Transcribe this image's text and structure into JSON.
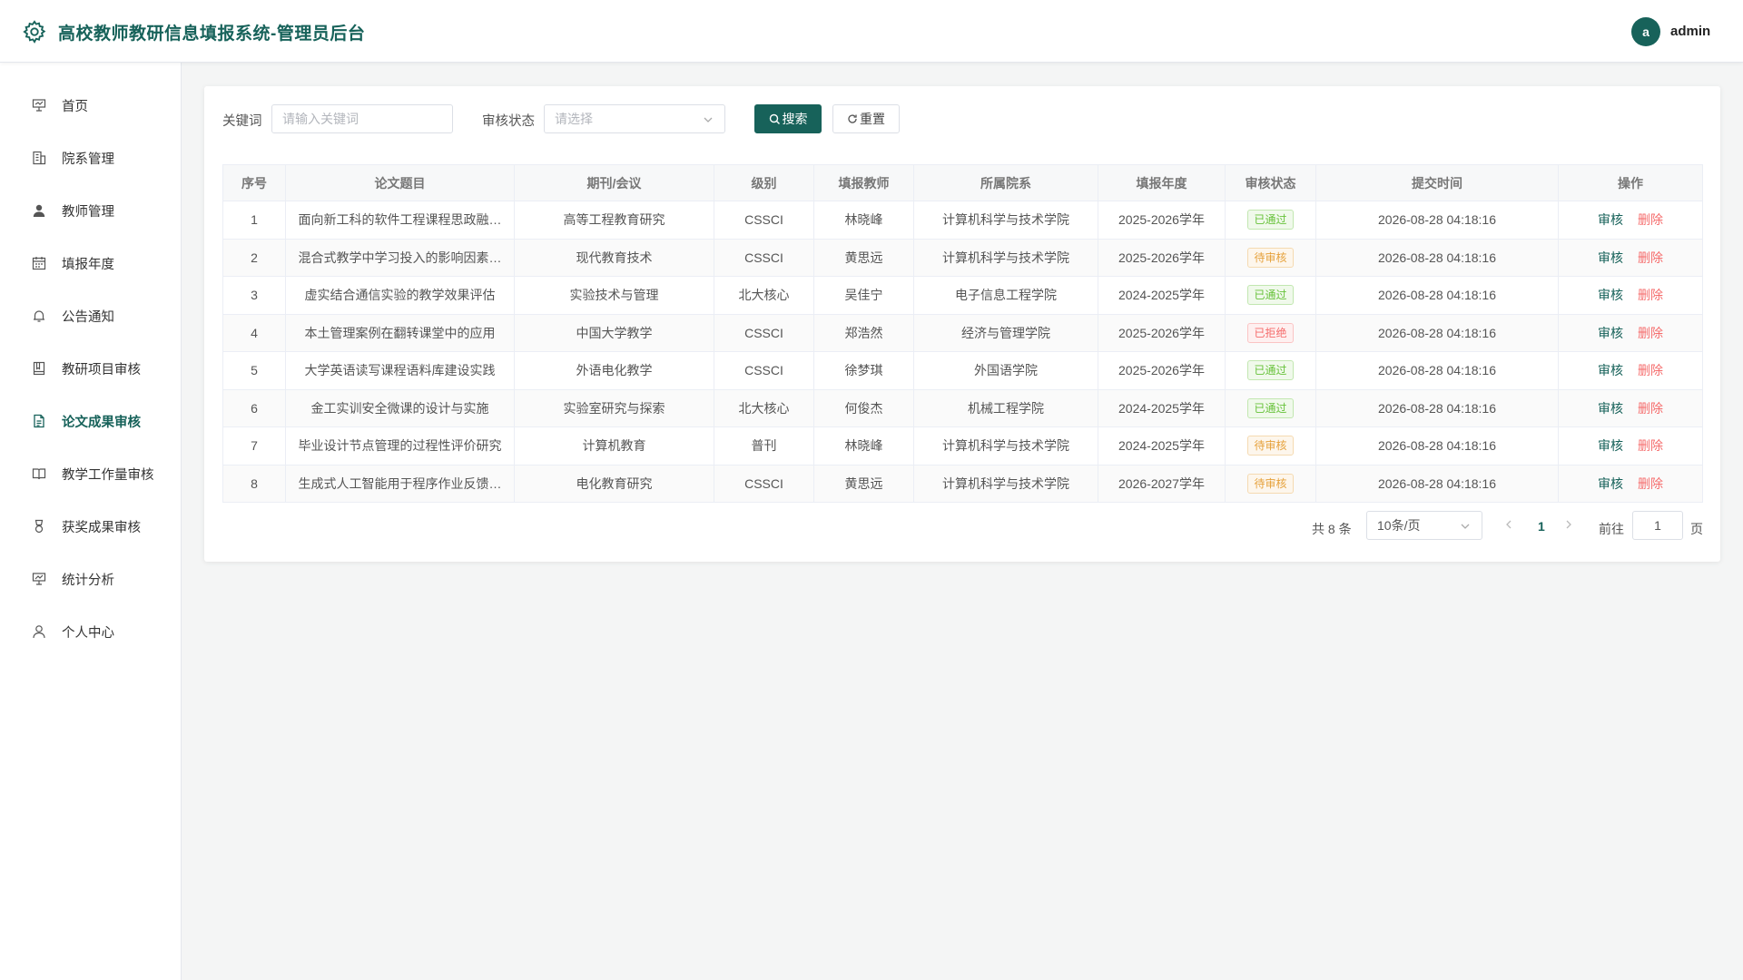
{
  "header": {
    "title": "高校教师教研信息填报系统-管理员后台",
    "avatar_letter": "a",
    "username": "admin",
    "accent": "#17625a"
  },
  "sidebar": {
    "items": [
      {
        "label": "首页",
        "icon": "presentation-icon"
      },
      {
        "label": "院系管理",
        "icon": "building-icon"
      },
      {
        "label": "教师管理",
        "icon": "user-filled-icon"
      },
      {
        "label": "填报年度",
        "icon": "calendar-icon"
      },
      {
        "label": "公告通知",
        "icon": "bell-icon"
      },
      {
        "label": "教研项目审核",
        "icon": "notebook-icon"
      },
      {
        "label": "论文成果审核",
        "icon": "document-icon",
        "active": true
      },
      {
        "label": "教学工作量审核",
        "icon": "book-icon"
      },
      {
        "label": "获奖成果审核",
        "icon": "medal-icon"
      },
      {
        "label": "统计分析",
        "icon": "chart-icon"
      },
      {
        "label": "个人中心",
        "icon": "user-icon"
      }
    ]
  },
  "filters": {
    "keyword_label": "关键词",
    "keyword_placeholder": "请输入关键词",
    "status_label": "审核状态",
    "status_placeholder": "请选择",
    "search_button": "搜索",
    "reset_button": "重置"
  },
  "table": {
    "columns": [
      "序号",
      "论文题目",
      "期刊/会议",
      "级别",
      "填报教师",
      "所属院系",
      "填报年度",
      "审核状态",
      "提交时间",
      "操作"
    ],
    "rows": [
      {
        "no": "1",
        "title": "面向新工科的软件工程课程思政融…",
        "journal": "高等工程教育研究",
        "level": "CSSCI",
        "teacher": "林晓峰",
        "dept": "计算机科学与技术学院",
        "year": "2025-2026学年",
        "status": "已通过",
        "status_type": "approved",
        "time": "2026-08-28 04:18:16"
      },
      {
        "no": "2",
        "title": "混合式教学中学习投入的影响因素…",
        "journal": "现代教育技术",
        "level": "CSSCI",
        "teacher": "黄思远",
        "dept": "计算机科学与技术学院",
        "year": "2025-2026学年",
        "status": "待审核",
        "status_type": "pending",
        "time": "2026-08-28 04:18:16"
      },
      {
        "no": "3",
        "title": "虚实结合通信实验的教学效果评估",
        "journal": "实验技术与管理",
        "level": "北大核心",
        "teacher": "吴佳宁",
        "dept": "电子信息工程学院",
        "year": "2024-2025学年",
        "status": "已通过",
        "status_type": "approved",
        "time": "2026-08-28 04:18:16"
      },
      {
        "no": "4",
        "title": "本土管理案例在翻转课堂中的应用",
        "journal": "中国大学教学",
        "level": "CSSCI",
        "teacher": "郑浩然",
        "dept": "经济与管理学院",
        "year": "2025-2026学年",
        "status": "已拒绝",
        "status_type": "rejected",
        "time": "2026-08-28 04:18:16"
      },
      {
        "no": "5",
        "title": "大学英语读写课程语料库建设实践",
        "journal": "外语电化教学",
        "level": "CSSCI",
        "teacher": "徐梦琪",
        "dept": "外国语学院",
        "year": "2025-2026学年",
        "status": "已通过",
        "status_type": "approved",
        "time": "2026-08-28 04:18:16"
      },
      {
        "no": "6",
        "title": "金工实训安全微课的设计与实施",
        "journal": "实验室研究与探索",
        "level": "北大核心",
        "teacher": "何俊杰",
        "dept": "机械工程学院",
        "year": "2024-2025学年",
        "status": "已通过",
        "status_type": "approved",
        "time": "2026-08-28 04:18:16"
      },
      {
        "no": "7",
        "title": "毕业设计节点管理的过程性评价研究",
        "journal": "计算机教育",
        "level": "普刊",
        "teacher": "林晓峰",
        "dept": "计算机科学与技术学院",
        "year": "2024-2025学年",
        "status": "待审核",
        "status_type": "pending",
        "time": "2026-08-28 04:18:16"
      },
      {
        "no": "8",
        "title": "生成式人工智能用于程序作业反馈…",
        "journal": "电化教育研究",
        "level": "CSSCI",
        "teacher": "黄思远",
        "dept": "计算机科学与技术学院",
        "year": "2026-2027学年",
        "status": "待审核",
        "status_type": "pending",
        "time": "2026-08-28 04:18:16"
      }
    ],
    "op_review": "审核",
    "op_delete": "删除",
    "status_colors": {
      "approved": {
        "text": "#67c23a",
        "bg": "#f0f9eb",
        "border": "#c2e7b0"
      },
      "pending": {
        "text": "#e6a23c",
        "bg": "#fdf6ec",
        "border": "#f5dab1"
      },
      "rejected": {
        "text": "#f56c6c",
        "bg": "#fef0f0",
        "border": "#fbc4c4"
      }
    }
  },
  "pagination": {
    "total_text": "共 8 条",
    "page_size": "10条/页",
    "current_page": "1",
    "goto_label": "前往",
    "goto_value": "1",
    "page_unit": "页"
  }
}
